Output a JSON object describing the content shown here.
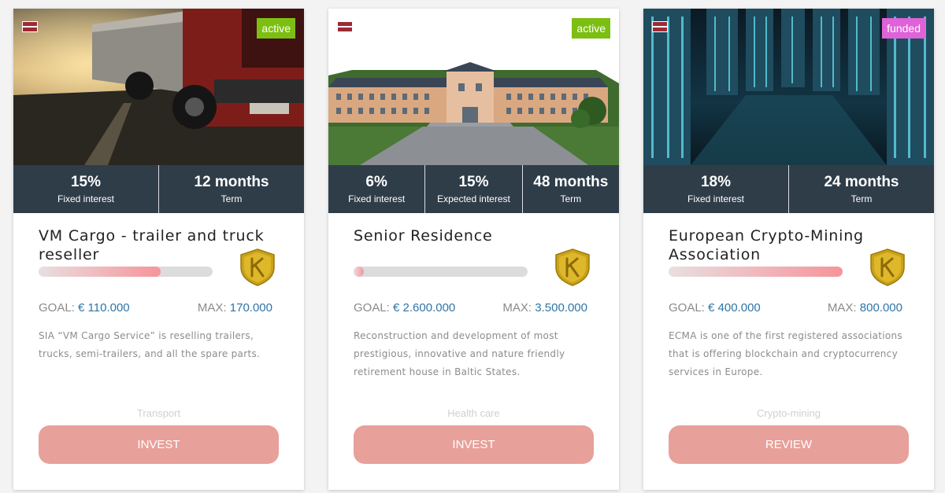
{
  "colors": {
    "stats_bg": "#2f3d49",
    "badge_active": "#7cbf12",
    "badge_funded": "#de62d8",
    "button_bg": "#e8a09a",
    "amount": "#2f75a6",
    "progress_fill": "#f6949b",
    "progress_track": "#dcdcdc"
  },
  "cards": [
    {
      "status": "active",
      "status_color": "#7cbf12",
      "flag": "latvia-flag-icon",
      "image": "truck-on-wet-road-photo",
      "stats": [
        {
          "value": "15%",
          "label": "Fixed interest"
        },
        {
          "value": "12 months",
          "label": "Term"
        }
      ],
      "title": "VM Cargo - trailer and truck reseller",
      "progress": 0.7,
      "goal_label": "GOAL:",
      "goal_amount": "€ 110.000",
      "max_label": "MAX:",
      "max_amount": "170.000",
      "description": "SIA “VM Cargo Service” is reselling trailers, trucks, semi-trailers, and all the spare parts.",
      "category": "Transport",
      "button": "INVEST"
    },
    {
      "status": "active",
      "status_color": "#7cbf12",
      "flag": "latvia-flag-icon",
      "image": "manor-building-render",
      "stats": [
        {
          "value": "6%",
          "label": "Fixed interest"
        },
        {
          "value": "15%",
          "label": "Expected interest"
        },
        {
          "value": "48 months",
          "label": "Term"
        }
      ],
      "title": "Senior Residence",
      "progress": 0.06,
      "goal_label": "GOAL:",
      "goal_amount": "€ 2.600.000",
      "max_label": "MAX:",
      "max_amount": "3.500.000",
      "description": "Reconstruction and development of most prestigious, innovative and nature friendly retirement house in Baltic States.",
      "category": "Health care",
      "button": "INVEST"
    },
    {
      "status": "funded",
      "status_color": "#de62d8",
      "flag": "latvia-flag-icon",
      "image": "server-room-photo",
      "stats": [
        {
          "value": "18%",
          "label": "Fixed interest"
        },
        {
          "value": "24 months",
          "label": "Term"
        }
      ],
      "title": "European Crypto-Mining Association",
      "progress": 1.0,
      "goal_label": "GOAL:",
      "goal_amount": "€ 400.000",
      "max_label": "MAX:",
      "max_amount": "800.000",
      "description": "ECMA is one of the first registered associations that is offering blockchain and cryptocurrency services in Europe.",
      "category": "Crypto-mining",
      "button": "REVIEW"
    }
  ]
}
